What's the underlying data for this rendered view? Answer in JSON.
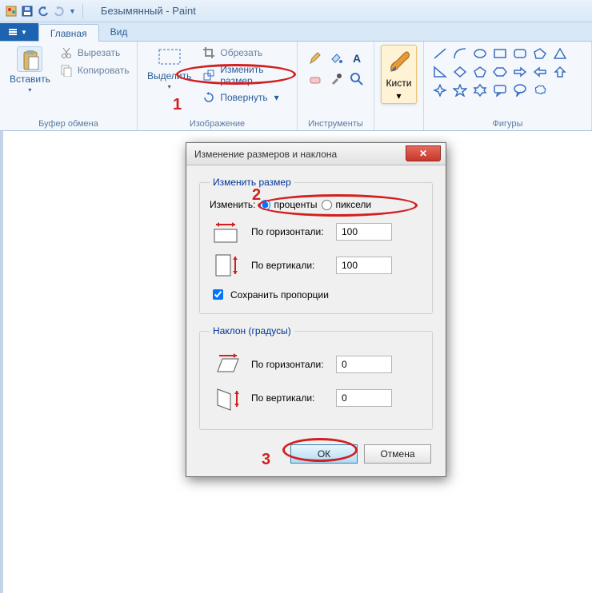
{
  "title": "Безымянный - Paint",
  "tabs": {
    "home": "Главная",
    "view": "Вид"
  },
  "clipboard": {
    "paste": "Вставить",
    "cut": "Вырезать",
    "copy": "Копировать",
    "group": "Буфер обмена"
  },
  "image": {
    "select": "Выделить",
    "crop": "Обрезать",
    "resize": "Изменить размер",
    "rotate": "Повернуть",
    "group": "Изображение"
  },
  "tools_group": "Инструменты",
  "brushes": "Кисти",
  "shapes_group": "Фигуры",
  "dialog": {
    "title": "Изменение размеров и наклона",
    "resize_legend": "Изменить размер",
    "by_label": "Изменить:",
    "percent": "проценты",
    "pixels": "пиксели",
    "horiz": "По горизонтали:",
    "vert": "По вертикали:",
    "h_val": "100",
    "v_val": "100",
    "keep_aspect": "Сохранить пропорции",
    "skew_legend": "Наклон (градусы)",
    "skew_h_val": "0",
    "skew_v_val": "0",
    "ok": "ОК",
    "cancel": "Отмена"
  },
  "annotations": {
    "n1": "1",
    "n2": "2",
    "n3": "3"
  }
}
